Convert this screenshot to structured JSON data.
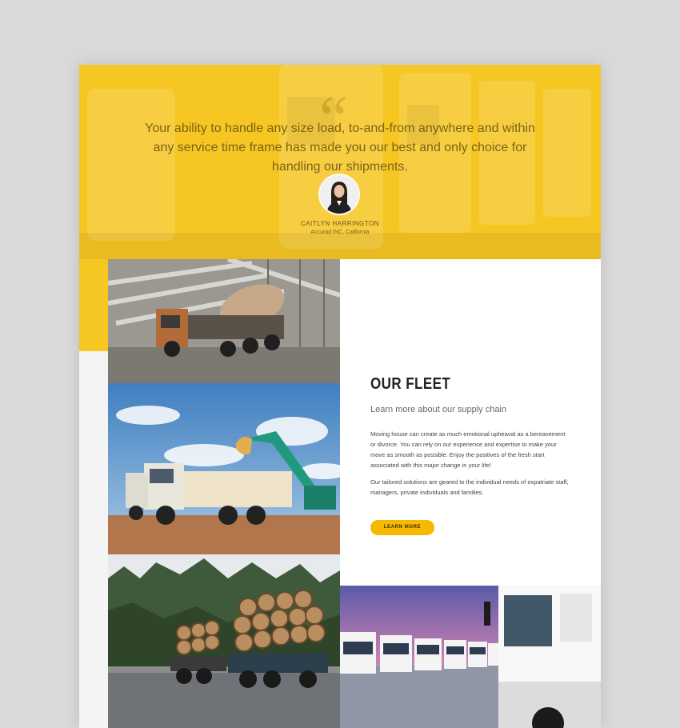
{
  "testimonial": {
    "quote": "Your ability to handle any size load, to-and-from anywhere and within any service time frame has made you our best and only choice for handling our shipments.",
    "name": "CAITLYN HARRINGTON",
    "company": "Accurad INC, California"
  },
  "fleet": {
    "title": "OUR FLEET",
    "subtitle": "Learn more about our supply chain",
    "paragraphs": [
      "Moving house can create as much emotional upheaval as a bereavement or divorce. You can rely on our experience and expertise to make your move as smooth as possible. Enjoy the positives of the fresh start associated with this major change in your life!",
      "Our tailored solutions are geared to the individual needs of expatriate staff, managers, private individuals and families."
    ],
    "button_label": "LEARN MORE"
  },
  "colors": {
    "accent": "#f6c623",
    "button": "#f6b800"
  }
}
